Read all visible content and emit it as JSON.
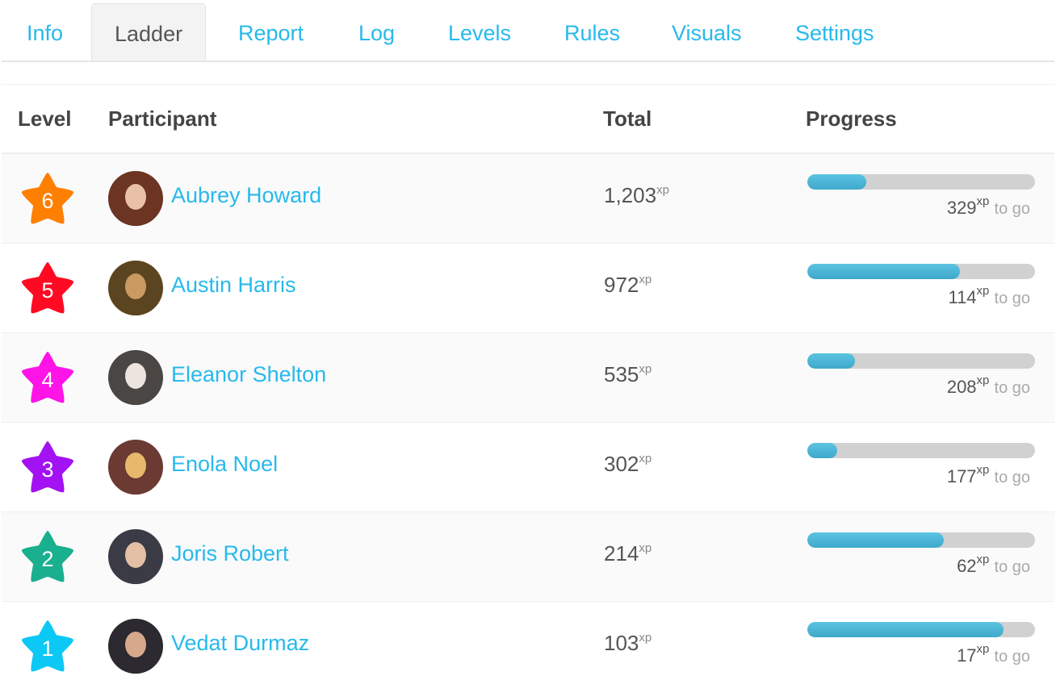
{
  "tabs": [
    {
      "label": "Info",
      "active": false
    },
    {
      "label": "Ladder",
      "active": true
    },
    {
      "label": "Report",
      "active": false
    },
    {
      "label": "Log",
      "active": false
    },
    {
      "label": "Levels",
      "active": false
    },
    {
      "label": "Rules",
      "active": false
    },
    {
      "label": "Visuals",
      "active": false
    },
    {
      "label": "Settings",
      "active": false
    }
  ],
  "table": {
    "headers": {
      "level": "Level",
      "participant": "Participant",
      "total": "Total",
      "progress": "Progress"
    },
    "xp_unit": "xp",
    "to_go_label": "to go",
    "rows": [
      {
        "level": "6",
        "level_color": "#ff7f00",
        "name": "Aubrey Howard",
        "avatar_colors": [
          "#6b3423",
          "#e9c0a8"
        ],
        "total": "1,203",
        "remaining": "329",
        "progress": 0.26
      },
      {
        "level": "5",
        "level_color": "#ff0a22",
        "name": "Austin Harris",
        "avatar_colors": [
          "#5b4520",
          "#c99a62"
        ],
        "total": "972",
        "remaining": "114",
        "progress": 0.67
      },
      {
        "level": "4",
        "level_color": "#ff14e8",
        "name": "Eleanor Shelton",
        "avatar_colors": [
          "#4a4643",
          "#ece4de"
        ],
        "total": "535",
        "remaining": "208",
        "progress": 0.21
      },
      {
        "level": "3",
        "level_color": "#a212f2",
        "name": "Enola Noel",
        "avatar_colors": [
          "#6a3a33",
          "#e8b96a"
        ],
        "total": "302",
        "remaining": "177",
        "progress": 0.13
      },
      {
        "level": "2",
        "level_color": "#19af8f",
        "name": "Joris Robert",
        "avatar_colors": [
          "#3b3b45",
          "#e3bfa6"
        ],
        "total": "214",
        "remaining": "62",
        "progress": 0.6
      },
      {
        "level": "1",
        "level_color": "#0cc8f5",
        "name": "Vedat Durmaz",
        "avatar_colors": [
          "#2c2a30",
          "#d6a88c"
        ],
        "total": "103",
        "remaining": "17",
        "progress": 0.86
      }
    ]
  }
}
